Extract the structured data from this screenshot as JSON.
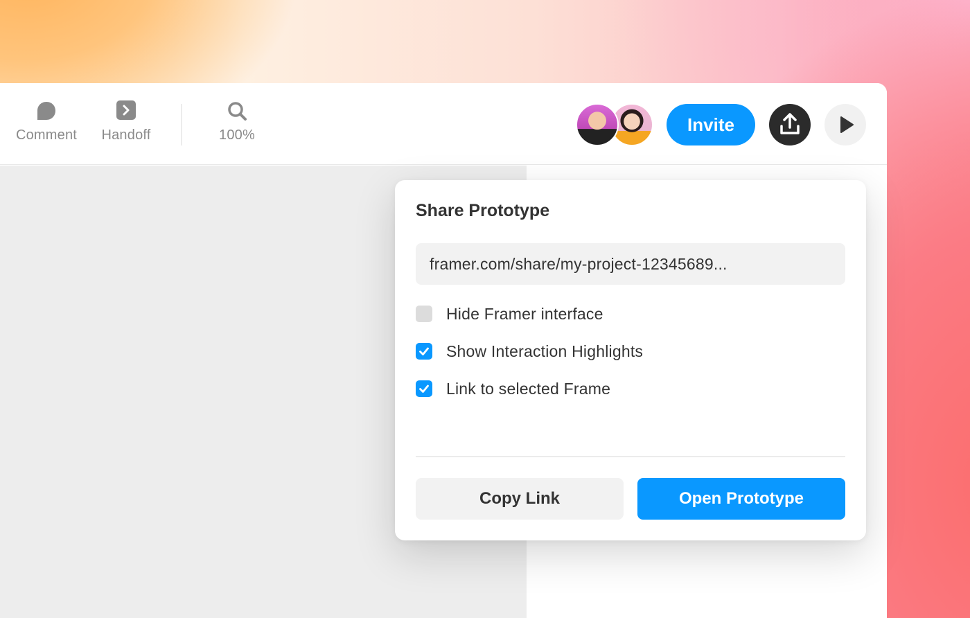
{
  "toolbar": {
    "tools": {
      "comment": {
        "label": "Comment",
        "icon": "comment-icon"
      },
      "handoff": {
        "label": "Handoff",
        "icon": "handoff-icon"
      },
      "zoom": {
        "label": "100%",
        "icon": "search-icon"
      }
    },
    "invite_label": "Invite",
    "publish_icon": "upload-icon",
    "preview_icon": "play-icon"
  },
  "share_popover": {
    "title": "Share Prototype",
    "url": "framer.com/share/my-project-12345689...",
    "options": [
      {
        "label": "Hide Framer interface",
        "checked": false
      },
      {
        "label": "Show Interaction Highlights",
        "checked": true
      },
      {
        "label": "Link to selected Frame",
        "checked": true
      }
    ],
    "copy_label": "Copy Link",
    "open_label": "Open Prototype"
  },
  "colors": {
    "accent": "#0a98ff",
    "dark_button": "#2b2b2b",
    "canvas": "#ededed"
  }
}
